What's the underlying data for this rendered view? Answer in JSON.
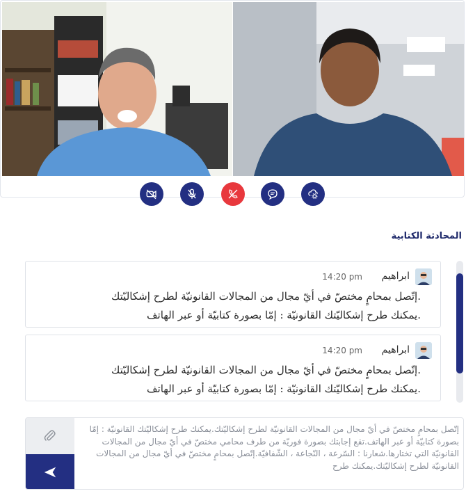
{
  "video": {
    "participants": [
      "participant-left",
      "participant-right"
    ],
    "controls": [
      {
        "name": "camera-off-icon",
        "style": "normal"
      },
      {
        "name": "mic-off-icon",
        "style": "normal"
      },
      {
        "name": "end-call-icon",
        "style": "danger"
      },
      {
        "name": "chat-icon",
        "style": "normal"
      },
      {
        "name": "settings-icon",
        "style": "normal"
      }
    ]
  },
  "chat": {
    "title": "المحادثة الكتابية",
    "messages": [
      {
        "sender": "ابراهيم",
        "time": "14:20 pm",
        "line1": ".إتّصل بمحامٍ مختصّ في أيّ مجال من المجالات القانونيّة لطرح إشكاليّتك",
        "line2": ".يمكنك طرح إشكاليّتك القانونيّة : إمّا بصورة كتابيّة أو عبر الهاتف"
      },
      {
        "sender": "ابراهيم",
        "time": "14:20 pm",
        "line1": ".إتّصل بمحامٍ مختصّ في أيّ مجال من المجالات القانونيّة لطرح إشكاليّتك",
        "line2": ".يمكنك طرح إشكاليّتك القانونيّة : إمّا بصورة كتابيّة أو عبر الهاتف"
      }
    ]
  },
  "composer": {
    "text": "إتّصل بمحامٍ مختصّ في أيّ مجال من المجالات القانونيّة لطرح إشكاليّتك.يمكنك طرح إشكاليّتك القانونيّة : إمّا بصورة كتابيّة أو عبر الهاتف.تقع إجابتك بصورة فوريّة من طرف محامي مختصّ في أيّ مجال من المجالات القانونيّة التي تختارها.شعارنا : السّرعة ، النّجاعة ، الشّفافيّة.إتّصل بمحامٍ مختصّ في أيّ مجال من المجالات القانونيّة لطرح إشكاليّتك.يمكنك طرح",
    "attach_icon": "paperclip-icon",
    "send_icon": "send-icon"
  },
  "colors": {
    "accent": "#232f82",
    "danger": "#e8383d",
    "title": "#1f2a6b"
  }
}
